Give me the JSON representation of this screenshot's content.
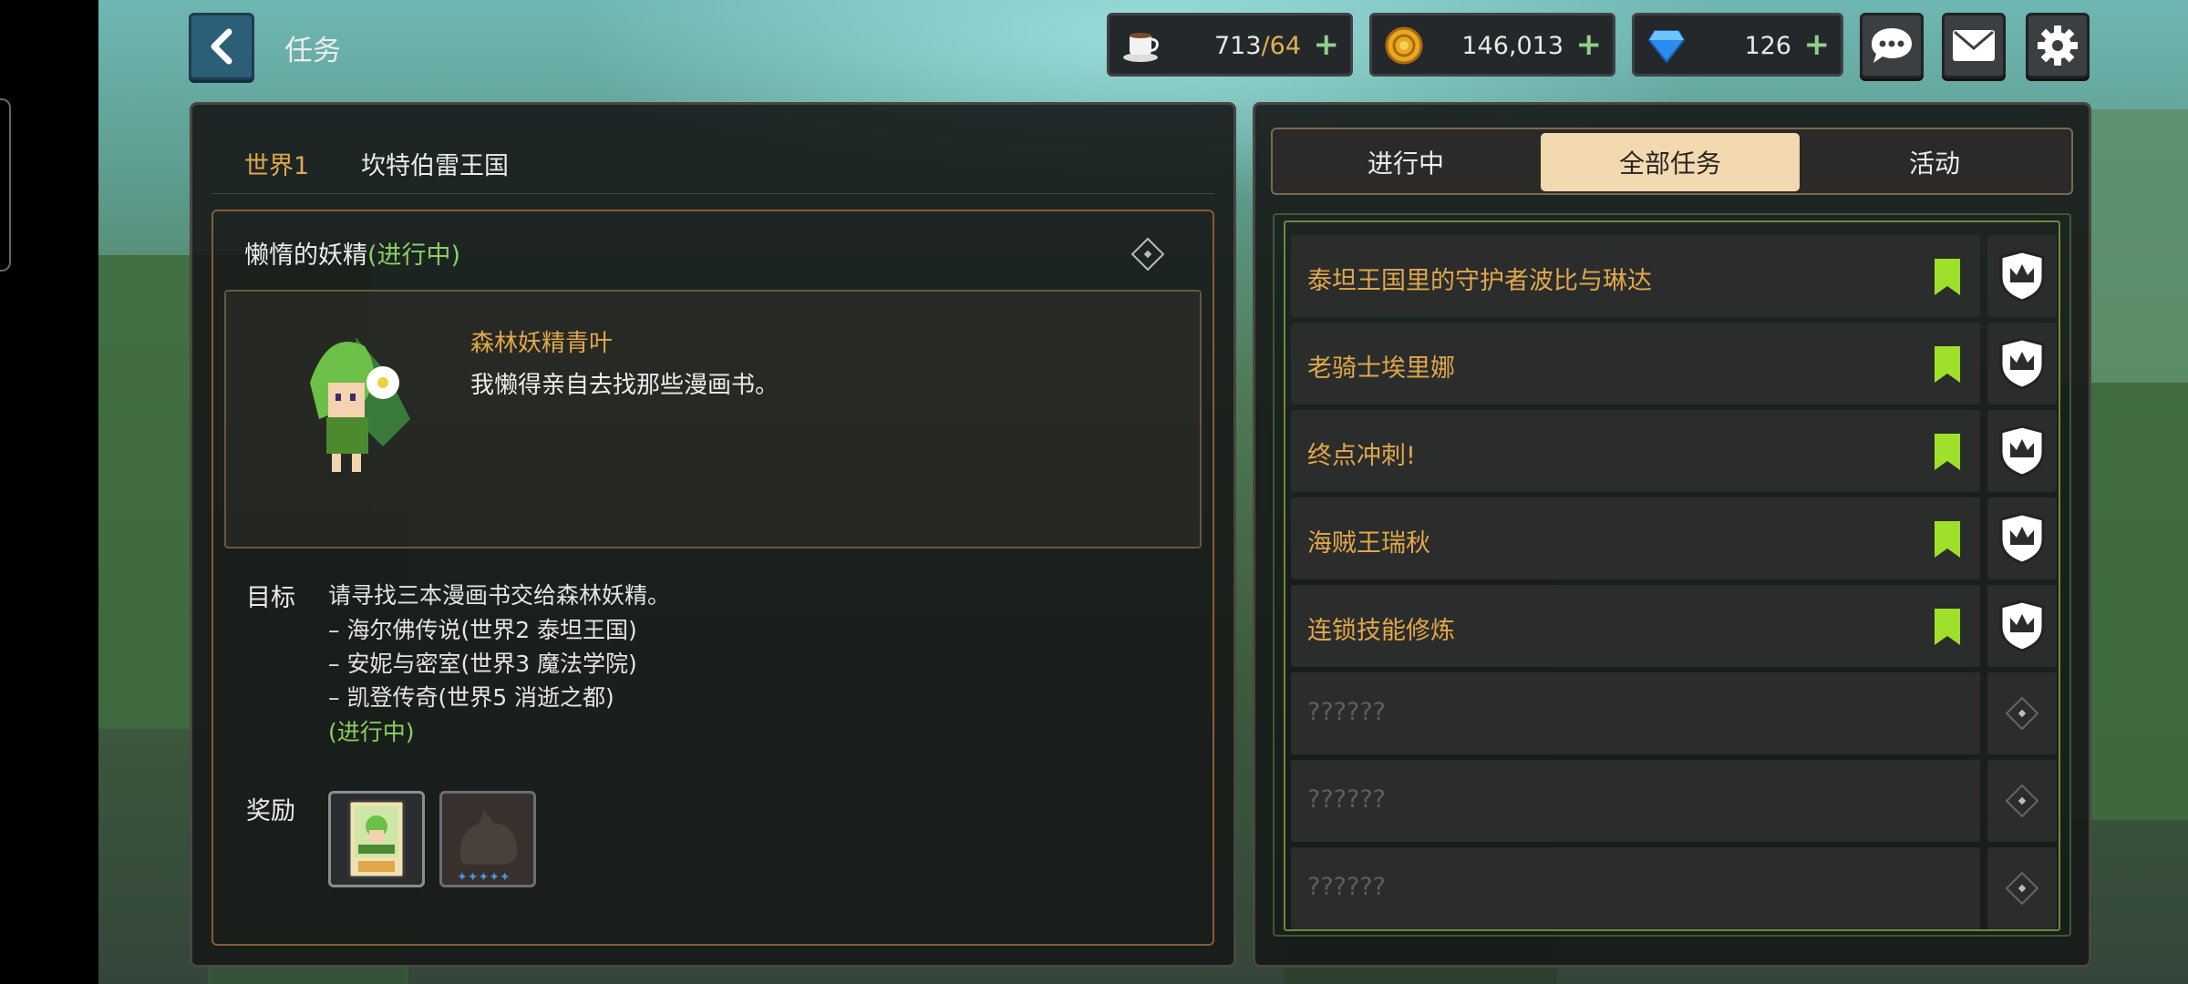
{
  "header": {
    "title": "任务",
    "stamina": {
      "current": "713",
      "max": "/64"
    },
    "gold": "146,013",
    "gems": "126"
  },
  "left": {
    "world_label": "世界1",
    "country": "坎特伯雷王国",
    "quest_name": "懒惰的妖精",
    "quest_status": "(进行中)",
    "npc_name": "森林妖精青叶",
    "npc_line": "我懒得亲自去找那些漫画书。",
    "goal_label": "目标",
    "goal_lines": [
      "请寻找三本漫画书交给森林妖精。",
      "–  海尔佛传说(世界2  泰坦王国)",
      "–  安妮与密室(世界3  魔法学院)",
      "–  凯登传奇(世界5  消逝之都)"
    ],
    "goal_status": "(进行中)",
    "reward_label": "奖励"
  },
  "right": {
    "tabs": [
      "进行中",
      "全部任务",
      "活动"
    ],
    "active_tab": 1,
    "quests": [
      {
        "title": "泰坦王国里的守护者波比与琳达",
        "known": true
      },
      {
        "title": "老骑士埃里娜",
        "known": true
      },
      {
        "title": "终点冲刺!",
        "known": true
      },
      {
        "title": "海贼王瑞秋",
        "known": true
      },
      {
        "title": "连锁技能修炼",
        "known": true
      },
      {
        "title": "??????",
        "known": false
      },
      {
        "title": "??????",
        "known": false
      },
      {
        "title": "??????",
        "known": false
      }
    ]
  },
  "colors": {
    "accent": "#e0a84a",
    "progress": "#8ad060",
    "flag": "#9ee02a",
    "active_tab": "#f3d9b0"
  }
}
